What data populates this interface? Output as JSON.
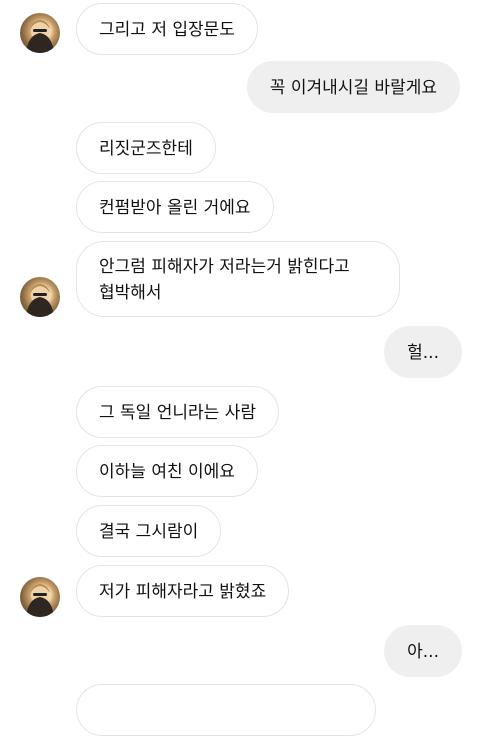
{
  "messages": [
    {
      "from": "them",
      "text": "그리고 저 입장문도"
    },
    {
      "from": "me",
      "text": "꼭 이겨내시길 바랄게요"
    },
    {
      "from": "them",
      "text": "리짓군즈한테"
    },
    {
      "from": "them",
      "text": "컨펌받아 올린 거에요"
    },
    {
      "from": "them",
      "line1": "안그럼 피해자가 저라는거 밝힌다고",
      "line2": "협박해서"
    },
    {
      "from": "me",
      "text": "헐..."
    },
    {
      "from": "them",
      "text": "그 독일 언니라는 사람"
    },
    {
      "from": "them",
      "text": "이하늘 여친 이에요"
    },
    {
      "from": "them",
      "text": "결국 그시람이"
    },
    {
      "from": "them",
      "text": "저가 피해자라고 밝혔죠"
    },
    {
      "from": "me",
      "text": "아..."
    }
  ]
}
